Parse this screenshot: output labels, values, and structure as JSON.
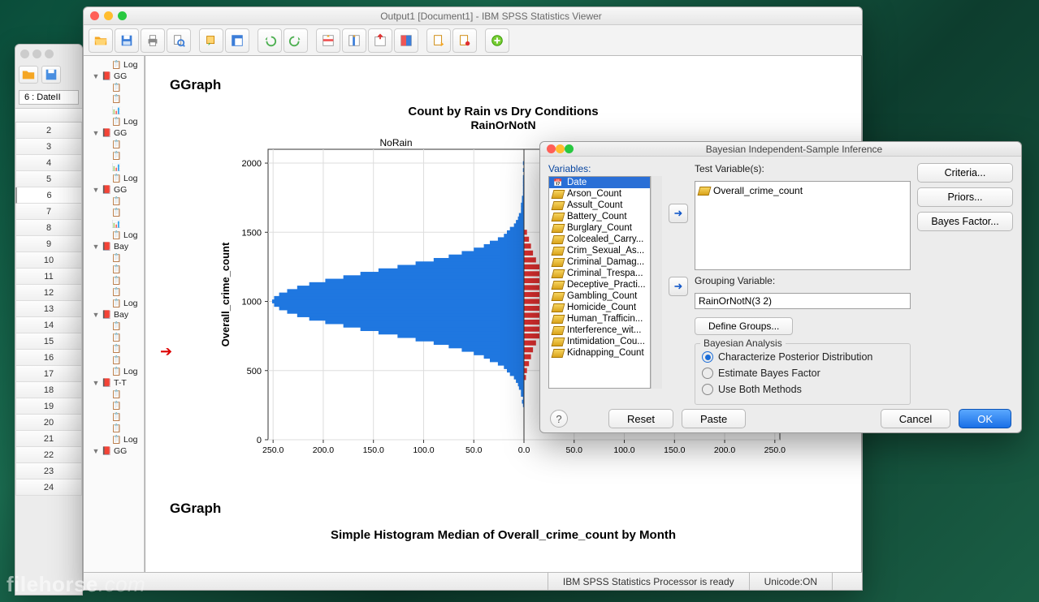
{
  "data_editor": {
    "cell_indicator": "6 : DateII",
    "rows": [
      2,
      3,
      4,
      5,
      6,
      7,
      8,
      9,
      10,
      11,
      12,
      13,
      14,
      15,
      16,
      17,
      18,
      19,
      20,
      21,
      22,
      23,
      24
    ],
    "selected_row": 6
  },
  "viewer": {
    "title": "Output1 [Document1] - IBM SPSS Statistics Viewer",
    "status_left": "IBM SPSS Statistics Processor is ready",
    "status_right": "Unicode:ON",
    "outline": [
      {
        "lvl": 2,
        "icon": "clip",
        "label": "Log"
      },
      {
        "lvl": 1,
        "icon": "book",
        "label": "GG",
        "tw": "▼"
      },
      {
        "lvl": 2,
        "icon": "clip",
        "label": ""
      },
      {
        "lvl": 2,
        "icon": "clip",
        "label": ""
      },
      {
        "lvl": 2,
        "icon": "chart",
        "label": ""
      },
      {
        "lvl": 2,
        "icon": "clip",
        "label": "Log"
      },
      {
        "lvl": 1,
        "icon": "book",
        "label": "GG",
        "tw": "▼"
      },
      {
        "lvl": 2,
        "icon": "clip",
        "label": ""
      },
      {
        "lvl": 2,
        "icon": "clip",
        "label": ""
      },
      {
        "lvl": 2,
        "icon": "chart",
        "label": ""
      },
      {
        "lvl": 2,
        "icon": "clip",
        "label": "Log"
      },
      {
        "lvl": 1,
        "icon": "book",
        "label": "GG",
        "tw": "▼"
      },
      {
        "lvl": 2,
        "icon": "clip",
        "label": ""
      },
      {
        "lvl": 2,
        "icon": "clip",
        "label": ""
      },
      {
        "lvl": 2,
        "icon": "chart",
        "label": ""
      },
      {
        "lvl": 2,
        "icon": "clip",
        "label": "Log"
      },
      {
        "lvl": 1,
        "icon": "book",
        "label": "Bay",
        "tw": "▼"
      },
      {
        "lvl": 2,
        "icon": "clip",
        "label": ""
      },
      {
        "lvl": 2,
        "icon": "clip",
        "label": ""
      },
      {
        "lvl": 2,
        "icon": "clip",
        "label": ""
      },
      {
        "lvl": 2,
        "icon": "clip",
        "label": ""
      },
      {
        "lvl": 2,
        "icon": "clip",
        "label": "Log"
      },
      {
        "lvl": 1,
        "icon": "book",
        "label": "Bay",
        "tw": "▼"
      },
      {
        "lvl": 2,
        "icon": "clip",
        "label": ""
      },
      {
        "lvl": 2,
        "icon": "clip",
        "label": ""
      },
      {
        "lvl": 2,
        "icon": "clip",
        "label": ""
      },
      {
        "lvl": 2,
        "icon": "clip",
        "label": ""
      },
      {
        "lvl": 2,
        "icon": "clip",
        "label": "Log"
      },
      {
        "lvl": 1,
        "icon": "book",
        "label": "T-T",
        "tw": "▼"
      },
      {
        "lvl": 2,
        "icon": "clip",
        "label": ""
      },
      {
        "lvl": 2,
        "icon": "clip",
        "label": ""
      },
      {
        "lvl": 2,
        "icon": "clip",
        "label": ""
      },
      {
        "lvl": 2,
        "icon": "clip",
        "label": ""
      },
      {
        "lvl": 2,
        "icon": "clip",
        "label": "Log"
      },
      {
        "lvl": 1,
        "icon": "book",
        "label": "GG",
        "tw": "▼"
      }
    ],
    "ggraph_label": "GGraph",
    "ggraph_label2": "GGraph",
    "chart2_title": "Simple Histogram Median of Overall_crime_count by Month"
  },
  "chart_data": {
    "type": "bar",
    "title": "Count by Rain vs Dry Conditions",
    "subtitle": "RainOrNotN",
    "panel_left_label": "NoRain",
    "panel_right_label": "",
    "ylabel": "Overall_crime_count",
    "xlabel": "",
    "y_ticks": [
      0,
      500,
      1000,
      1500,
      2000
    ],
    "x_ticks_left": [
      250.0,
      200.0,
      150.0,
      100.0,
      50.0,
      0.0
    ],
    "x_ticks_right": [
      0.0,
      50.0,
      100.0,
      150.0,
      200.0,
      250.0
    ],
    "ylim": [
      0,
      2100
    ],
    "series": [
      {
        "name": "NoRain",
        "color": "#1f77e0",
        "x": [
          250,
          275,
          300,
          325,
          350,
          375,
          400,
          425,
          450,
          475,
          500,
          525,
          550,
          575,
          600,
          625,
          650,
          675,
          700,
          725,
          750,
          775,
          800,
          825,
          850,
          875,
          900,
          925,
          950,
          975,
          1000,
          1025,
          1050,
          1075,
          1100,
          1125,
          1150,
          1175,
          1200,
          1225,
          1250,
          1275,
          1300,
          1325,
          1350,
          1375,
          1400,
          1425,
          1450,
          1475,
          1500,
          1525,
          1550,
          1575,
          1600,
          1625,
          1650,
          1675,
          1700,
          1725,
          1750,
          1775,
          1800,
          1825,
          1850,
          1875,
          1900,
          1950,
          2000
        ],
        "values": [
          1,
          2,
          1,
          3,
          3,
          5,
          6,
          8,
          10,
          14,
          17,
          20,
          26,
          34,
          40,
          50,
          62,
          75,
          90,
          108,
          126,
          145,
          163,
          180,
          198,
          214,
          226,
          236,
          244,
          249,
          251,
          249,
          244,
          236,
          226,
          214,
          198,
          180,
          163,
          145,
          126,
          108,
          90,
          75,
          62,
          50,
          40,
          34,
          26,
          20,
          17,
          14,
          10,
          8,
          6,
          5,
          3,
          3,
          3,
          2,
          2,
          1,
          1,
          1,
          1,
          1,
          1,
          1,
          1
        ]
      },
      {
        "name": "Rain",
        "color": "#e03030",
        "x": [
          450,
          500,
          550,
          600,
          650,
          700,
          750,
          800,
          850,
          900,
          950,
          1000,
          1050,
          1100,
          1150,
          1200,
          1250,
          1300,
          1350,
          1400,
          1450,
          1500
        ],
        "values": [
          2,
          3,
          5,
          7,
          9,
          12,
          16,
          20,
          24,
          27,
          29,
          30,
          29,
          27,
          24,
          20,
          16,
          12,
          9,
          7,
          5,
          3
        ]
      }
    ]
  },
  "dialog": {
    "title": "Bayesian Independent-Sample Inference",
    "variables_label": "Variables:",
    "testvars_label": "Test Variable(s):",
    "grouping_label": "Grouping Variable:",
    "grouping_value": "RainOrNotN(3 2)",
    "define_groups": "Define Groups...",
    "analysis_legend": "Bayesian Analysis",
    "radio_characterize": "Characterize Posterior Distribution",
    "radio_estimate": "Estimate Bayes Factor",
    "radio_both": "Use Both Methods",
    "side_criteria": "Criteria...",
    "side_priors": "Priors...",
    "side_bayes": "Bayes Factor...",
    "btn_reset": "Reset",
    "btn_paste": "Paste",
    "btn_cancel": "Cancel",
    "btn_ok": "OK",
    "variables": [
      "Date",
      "Arson_Count",
      "Assult_Count",
      "Battery_Count",
      "Burglary_Count",
      "Colcealed_Carry...",
      "Crim_Sexual_As...",
      "Criminal_Damag...",
      "Criminal_Trespa...",
      "Deceptive_Practi...",
      "Gambling_Count",
      "Homicide_Count",
      "Human_Trafficin...",
      "Interference_wit...",
      "Intimidation_Cou...",
      "Kidnapping_Count"
    ],
    "selected_variable": "Date",
    "test_variable": "Overall_crime_count"
  },
  "watermark": {
    "a": "filehorse",
    "b": ".com"
  }
}
